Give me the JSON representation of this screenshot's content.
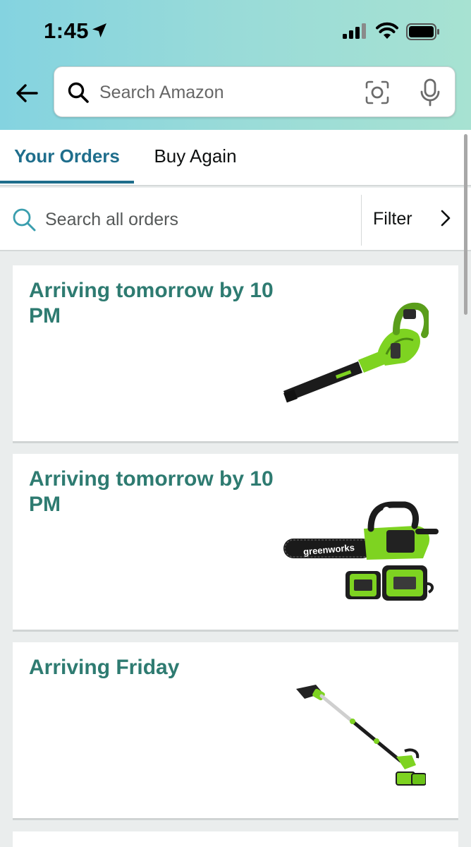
{
  "status_bar": {
    "time": "1:45"
  },
  "search": {
    "placeholder": "Search Amazon"
  },
  "tabs": [
    {
      "label": "Your Orders",
      "active": true
    },
    {
      "label": "Buy Again",
      "active": false
    }
  ],
  "order_search": {
    "placeholder": "Search all orders",
    "filter_label": "Filter"
  },
  "orders": [
    {
      "status": "Arriving tomorrow by 10 PM",
      "image": "leaf-blower"
    },
    {
      "status": "Arriving tomorrow by 10 PM",
      "image": "chainsaw-kit",
      "brand_text": "greenworks"
    },
    {
      "status": "Arriving Friday",
      "image": "pole-saw"
    }
  ],
  "colors": {
    "header_gradient": [
      "#84d3e0",
      "#a7e2d2"
    ],
    "active_tab": "#1f6e8c",
    "delivery_status": "#2e7b71",
    "product_green": "#7ed321"
  }
}
